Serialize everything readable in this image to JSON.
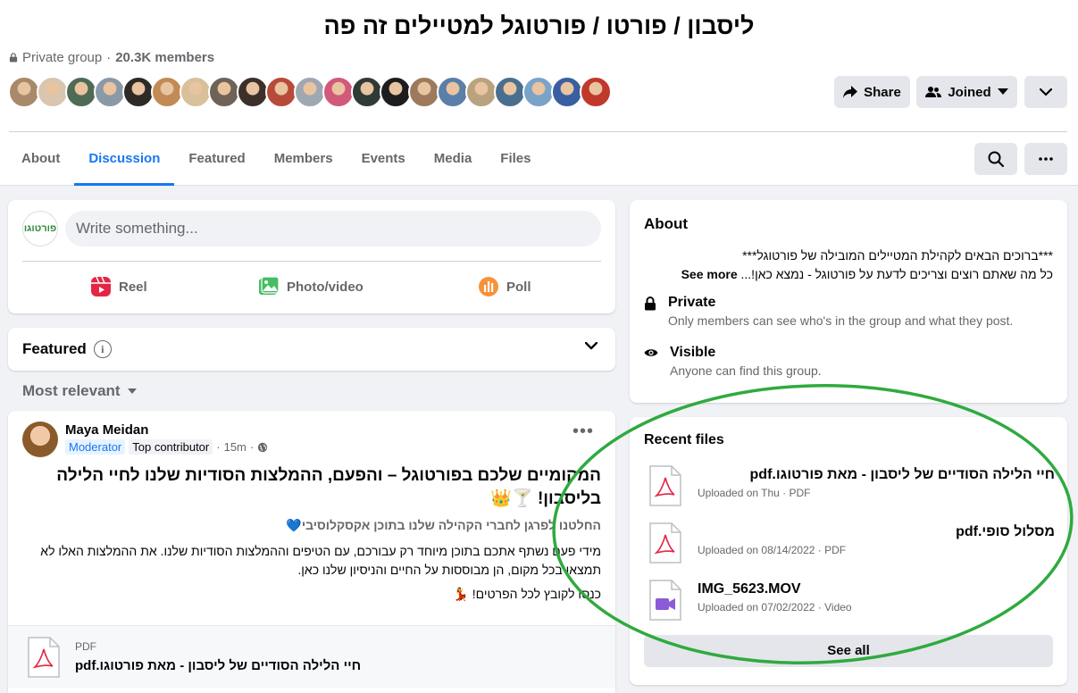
{
  "group": {
    "title": "ליסבון / פורטו / פורטוגל למטיילים זה פה",
    "privacy": "Private group",
    "separator": "·",
    "members": "20.3K members"
  },
  "header_buttons": {
    "share": "Share",
    "joined": "Joined"
  },
  "member_avatar_colors": [
    "#a88a6a",
    "#d9c6b0",
    "#4f6b55",
    "#8a99a8",
    "#2d2a28",
    "#c28a55",
    "#d8c09a",
    "#6f6257",
    "#3d2f2a",
    "#b84a3a",
    "#9fa7b3",
    "#d15a7a",
    "#2e3b37",
    "#1d1d1f",
    "#9c7a5b",
    "#5a7fa8",
    "#b9a27e",
    "#4a6f8e",
    "#7aa3c8",
    "#3a5fa0",
    "#c0392b"
  ],
  "tabs": [
    "About",
    "Discussion",
    "Featured",
    "Members",
    "Events",
    "Media",
    "Files"
  ],
  "active_tab": "Discussion",
  "composer": {
    "logo_text": "פורטוגו",
    "placeholder": "Write something...",
    "reel": "Reel",
    "photo": "Photo/video",
    "poll": "Poll"
  },
  "featured": {
    "label": "Featured",
    "info": "i"
  },
  "sort": {
    "label": "Most relevant"
  },
  "post": {
    "author": "Maya Meidan",
    "badge_moderator": "Moderator",
    "badge_top": "Top contributor",
    "time": "15m",
    "dot": "·",
    "headline": "המקומיים שלכם בפורטוגל – והפעם, ההמלצות הסודיות שלנו לחיי הלילה בליסבון! 🍸👑",
    "subline": "החלטנו לפרגן לחברי הקהילה שלנו בתוכן אקסקלוסיבי💙",
    "paragraph": "מידי פעם נשתף אתכם בתוכן מיוחד רק עבורכם, עם הטיפים וההמלצות הסודיות שלנו. את ההמלצות האלו לא תמצאו בכל מקום, הן מבוססות על החיים והניסיון שלנו כאן.",
    "cta": "כנסו לקובץ לכל הפרטים! 💃",
    "attachment": {
      "type": "PDF",
      "name": "חיי הלילה הסודיים של ליסבון - מאת פורטוגו.pdf"
    }
  },
  "about": {
    "title": "About",
    "desc_line1": "***ברוכים הבאים לקהילת המטיילים המובילה של פורטוגל***",
    "desc_line2": "כל מה שאתם רוצים וצריכים לדעת על פורטוגל - נמצא כאן!...",
    "see_more": "See more",
    "private_title": "Private",
    "private_desc": "Only members can see who's in the group and what they post.",
    "visible_title": "Visible",
    "visible_desc": "Anyone can find this group."
  },
  "recent_files": {
    "title": "Recent files",
    "items": [
      {
        "name": "חיי הלילה הסודיים של ליסבון - מאת פורטוגו.pdf",
        "meta": "Uploaded on Thu · PDF",
        "icon": "pdf-icon"
      },
      {
        "name": "מסלול סופי.pdf",
        "meta": "Uploaded on 08/14/2022 · PDF",
        "icon": "pdf-icon"
      },
      {
        "name": "IMG_5623.MOV",
        "meta": "Uploaded on 07/02/2022 · Video",
        "icon": "video-icon"
      }
    ],
    "see_all": "See all"
  },
  "colors": {
    "accent": "#1877f2",
    "highlight_ring": "#2faa3f"
  }
}
